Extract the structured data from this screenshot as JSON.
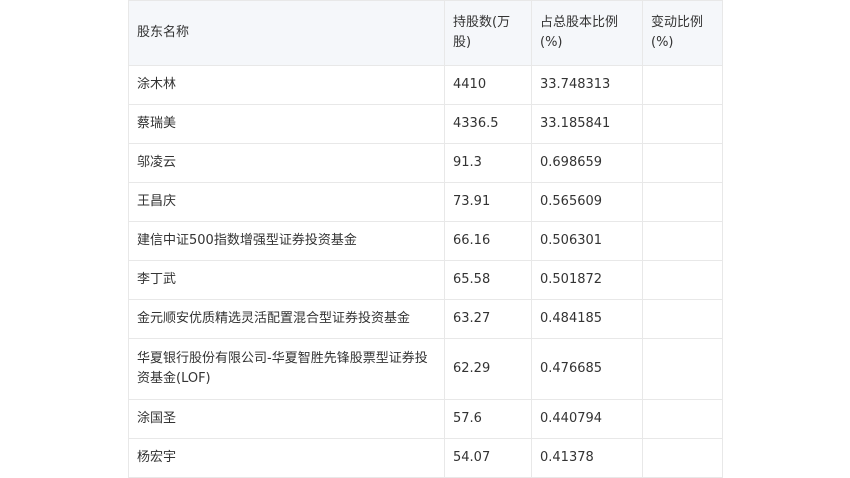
{
  "table": {
    "headers": [
      "股东名称",
      "持股数(万股)",
      "占总股本比例(%)",
      "变动比例(%)"
    ],
    "rows": [
      [
        "涂木林",
        "4410",
        "33.748313",
        ""
      ],
      [
        "蔡瑞美",
        "4336.5",
        "33.185841",
        ""
      ],
      [
        "邬凌云",
        "91.3",
        "0.698659",
        ""
      ],
      [
        "王昌庆",
        "73.91",
        "0.565609",
        ""
      ],
      [
        "建信中证500指数增强型证券投资基金",
        "66.16",
        "0.506301",
        ""
      ],
      [
        "李丁武",
        "65.58",
        "0.501872",
        ""
      ],
      [
        "金元顺安优质精选灵活配置混合型证券投资基金",
        "63.27",
        "0.484185",
        ""
      ],
      [
        "华夏银行股份有限公司-华夏智胜先锋股票型证券投资基金(LOF)",
        "62.29",
        "0.476685",
        ""
      ],
      [
        "涂国圣",
        "57.6",
        "0.440794",
        ""
      ],
      [
        "杨宏宇",
        "54.07",
        "0.41378",
        ""
      ]
    ]
  }
}
